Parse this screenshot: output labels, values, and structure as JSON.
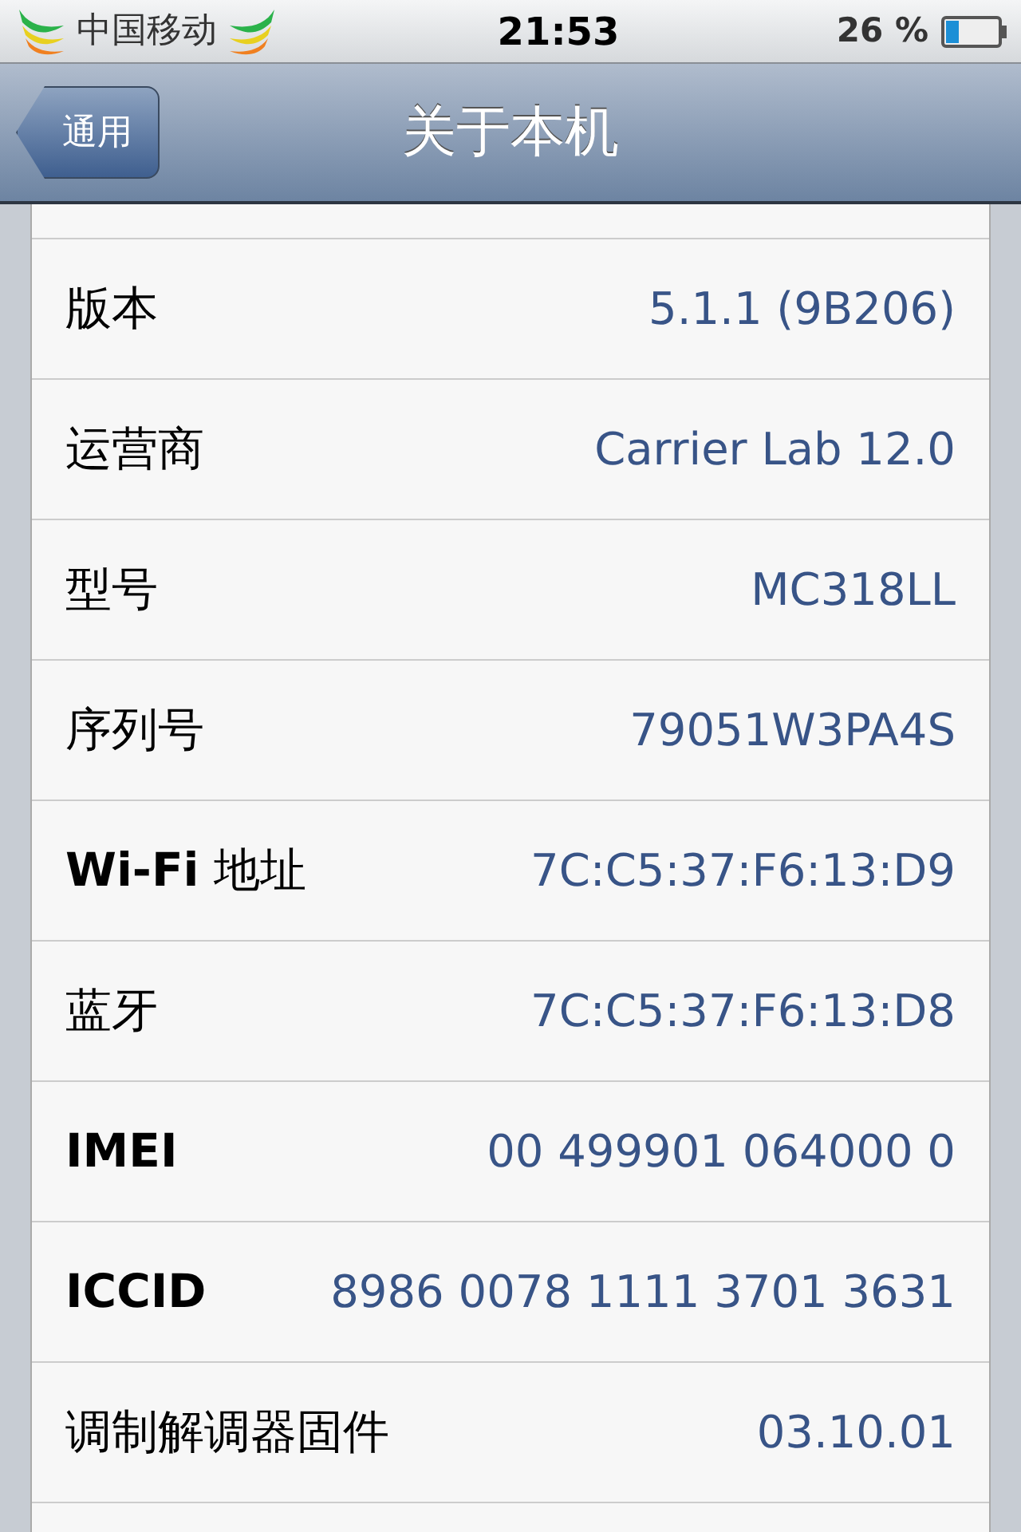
{
  "status_bar": {
    "carrier": "中国移动",
    "time": "21:53",
    "battery": "26 %"
  },
  "nav_bar": {
    "back": "通用",
    "title": "关于本机"
  },
  "rows": [
    {
      "label": "版本",
      "value": "5.1.1 (9B206)"
    },
    {
      "label": "运营商",
      "value": "Carrier Lab 12.0"
    },
    {
      "label": "型号",
      "value": "MC318LL"
    },
    {
      "label": "序列号",
      "value": "79051W3PA4S"
    },
    {
      "label": "**Wi-Fi** 地址",
      "value": "7C:C5:37:F6:13:D9"
    },
    {
      "label": "蓝牙",
      "value": "7C:C5:37:F6:13:D8"
    },
    {
      "label": "**IMEI**",
      "value": "00 499901 064000 0"
    },
    {
      "label": "**ICCID**",
      "value": "8986 0078 1111 3701 3631"
    },
    {
      "label": "调制解调器固件",
      "value": "03.10.01"
    }
  ]
}
